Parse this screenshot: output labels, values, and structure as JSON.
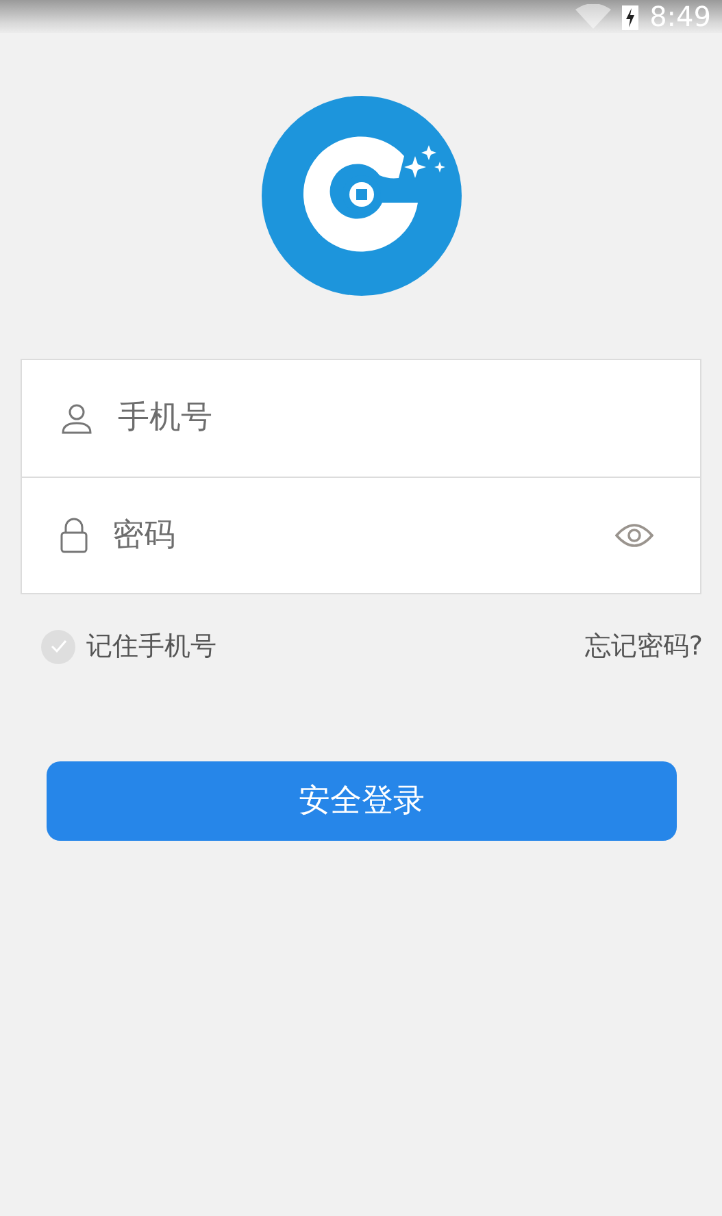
{
  "status_bar": {
    "time": "8:49"
  },
  "fields": [
    {
      "kind": "phone",
      "placeholder": "手机号"
    },
    {
      "kind": "password",
      "placeholder": "密码"
    }
  ],
  "remember": {
    "label": "记住手机号",
    "checked": false
  },
  "forgot_link": "忘记密码?",
  "login_button": "安全登录"
}
